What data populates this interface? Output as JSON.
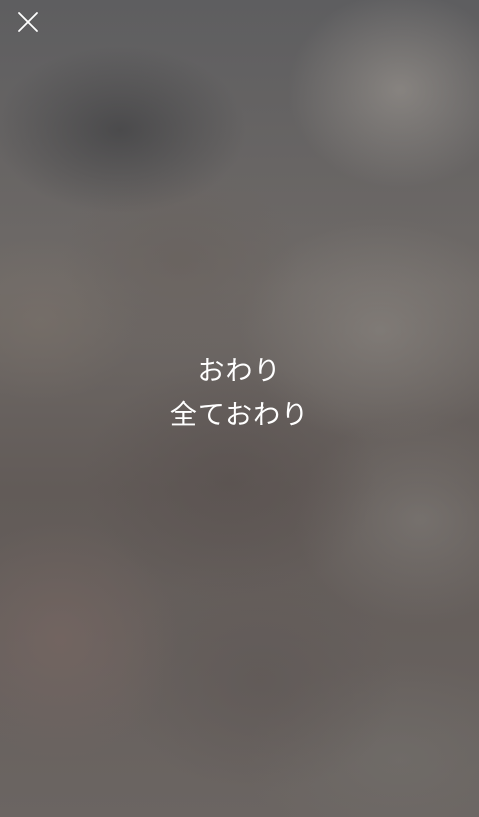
{
  "overlay": {
    "close_icon": "close-icon",
    "title": "おわり",
    "subtitle": "全ておわり",
    "text_color": "#ffffff"
  }
}
